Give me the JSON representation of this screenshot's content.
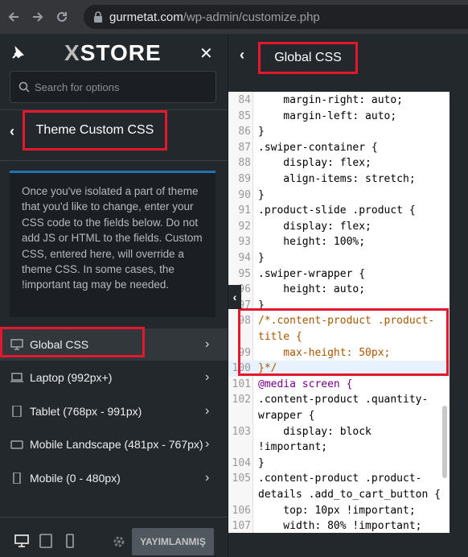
{
  "browser": {
    "url_host": "gurmetat.com",
    "url_path": "/wp-admin/customize.php"
  },
  "sidebar": {
    "logo_prefix": "X",
    "logo_text": "STORE",
    "search_placeholder": "Search for options",
    "section_title": "Theme Custom CSS",
    "description": "Once you've isolated a part of theme that you'd like to change, enter your CSS code to the fields below. Do not add JS or HTML to the fields. Custom CSS, entered here, will override a theme CSS. In some cases, the !important tag may be needed.",
    "items": [
      {
        "label": "Global CSS",
        "icon": "desktop-icon",
        "active": true
      },
      {
        "label": "Laptop (992px+)",
        "icon": "laptop-icon"
      },
      {
        "label": "Tablet (768px - 991px)",
        "icon": "tablet-icon"
      },
      {
        "label": "Mobile Landscape (481px - 767px)",
        "icon": "mobile-landscape-icon"
      },
      {
        "label": "Mobile (0 - 480px)",
        "icon": "mobile-icon"
      }
    ],
    "publish_label": "YAYIMLANMIŞ"
  },
  "panel": {
    "title": "Global CSS"
  },
  "editor": {
    "lines": [
      {
        "n": "84",
        "text": "    margin-right: auto;"
      },
      {
        "n": "85",
        "text": "    margin-left: auto;"
      },
      {
        "n": "86",
        "text": "}"
      },
      {
        "n": "87",
        "text": ".swiper-container {"
      },
      {
        "n": "88",
        "text": "    display: flex;"
      },
      {
        "n": "89",
        "text": "    align-items: stretch;"
      },
      {
        "n": "90",
        "text": "}"
      },
      {
        "n": "91",
        "text": ".product-slide .product {"
      },
      {
        "n": "92",
        "text": "    display: flex;"
      },
      {
        "n": "93",
        "text": "    height: 100%;"
      },
      {
        "n": "94",
        "text": "}"
      },
      {
        "n": "95",
        "text": ".swiper-wrapper {"
      },
      {
        "n": "96",
        "text": "    height: auto;"
      },
      {
        "n": "97",
        "text": "}"
      },
      {
        "n": "98",
        "text": "/*.content-product .product-"
      },
      {
        "n": "",
        "text": "title {"
      },
      {
        "n": "99",
        "text": "    max-height: 50px;"
      },
      {
        "n": "100",
        "text": "}*/"
      },
      {
        "n": "101",
        "text": "@media screen {"
      },
      {
        "n": "102",
        "text": ".content-product .quantity-"
      },
      {
        "n": "",
        "text": "wrapper {"
      },
      {
        "n": "103",
        "text": "    display: block"
      },
      {
        "n": "",
        "text": "!important;"
      },
      {
        "n": "104",
        "text": "}"
      },
      {
        "n": "105",
        "text": ".content-product .product-"
      },
      {
        "n": "",
        "text": "details .add_to_cart_button {"
      },
      {
        "n": "106",
        "text": "    top: 10px !important;"
      },
      {
        "n": "107",
        "text": "    width: 80% !important;"
      }
    ]
  }
}
